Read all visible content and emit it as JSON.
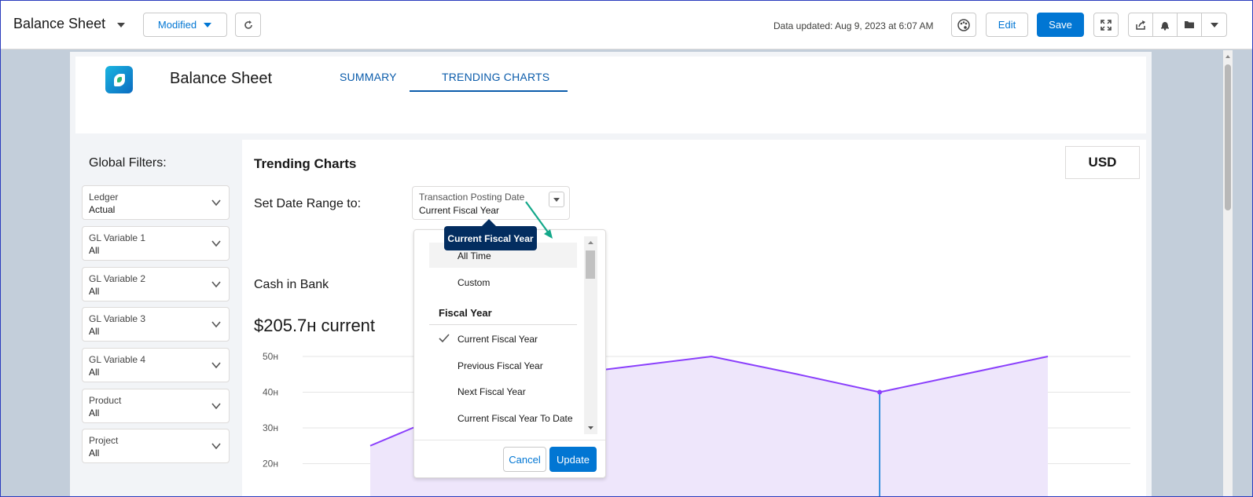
{
  "topbar": {
    "title": "Balance Sheet",
    "modified_label": "Modified",
    "data_updated": "Data updated: Aug 9, 2023 at 6:07 AM",
    "edit_label": "Edit",
    "save_label": "Save"
  },
  "header": {
    "sheet_title": "Balance Sheet",
    "tabs": [
      {
        "label": "SUMMARY",
        "active": false
      },
      {
        "label": "TRENDING CHARTS",
        "active": true
      }
    ]
  },
  "filters": {
    "title": "Global Filters:",
    "items": [
      {
        "label": "Ledger",
        "value": "Actual"
      },
      {
        "label": "GL Variable 1",
        "value": "All"
      },
      {
        "label": "GL Variable 2",
        "value": "All"
      },
      {
        "label": "GL Variable 3",
        "value": "All"
      },
      {
        "label": "GL Variable 4",
        "value": "All"
      },
      {
        "label": "Product",
        "value": "All"
      },
      {
        "label": "Project",
        "value": "All"
      }
    ]
  },
  "main": {
    "title": "Trending Charts",
    "currency": "USD",
    "range_label": "Set Date Range to:",
    "date_field_label": "Transaction Posting Date",
    "date_field_value": "Current Fiscal Year",
    "tooltip": "Current Fiscal Year",
    "cash_label": "Cash in Bank",
    "cash_value": "$205.7ʜ current"
  },
  "dropdown": {
    "items_top": [
      "All Time",
      "Custom"
    ],
    "section": "Fiscal Year",
    "items_fiscal": [
      "Current Fiscal Year",
      "Previous Fiscal Year",
      "Next Fiscal Year",
      "Current Fiscal Year To Date"
    ],
    "selected": "Current Fiscal Year",
    "hovered": "All Time",
    "cancel_label": "Cancel",
    "update_label": "Update"
  },
  "chart_data": {
    "type": "area",
    "ytick_labels": [
      "50ʜ",
      "40ʜ",
      "30ʜ",
      "20ʜ"
    ],
    "yticks": [
      50000,
      40000,
      30000,
      20000
    ],
    "x": [
      1,
      2,
      3,
      4,
      5,
      6,
      7
    ],
    "y": [
      25000,
      30000,
      45000,
      50000,
      45000,
      40000,
      50000
    ],
    "highlight_index": 5,
    "ylim": [
      20000,
      50000
    ],
    "color": "#8a3ffc",
    "fill": "#eee6fb"
  },
  "colors": {
    "brand": "#0176d3",
    "tab": "#0b5cab",
    "tooltip": "#032d60",
    "annotation_arrow": "#14a88a"
  }
}
